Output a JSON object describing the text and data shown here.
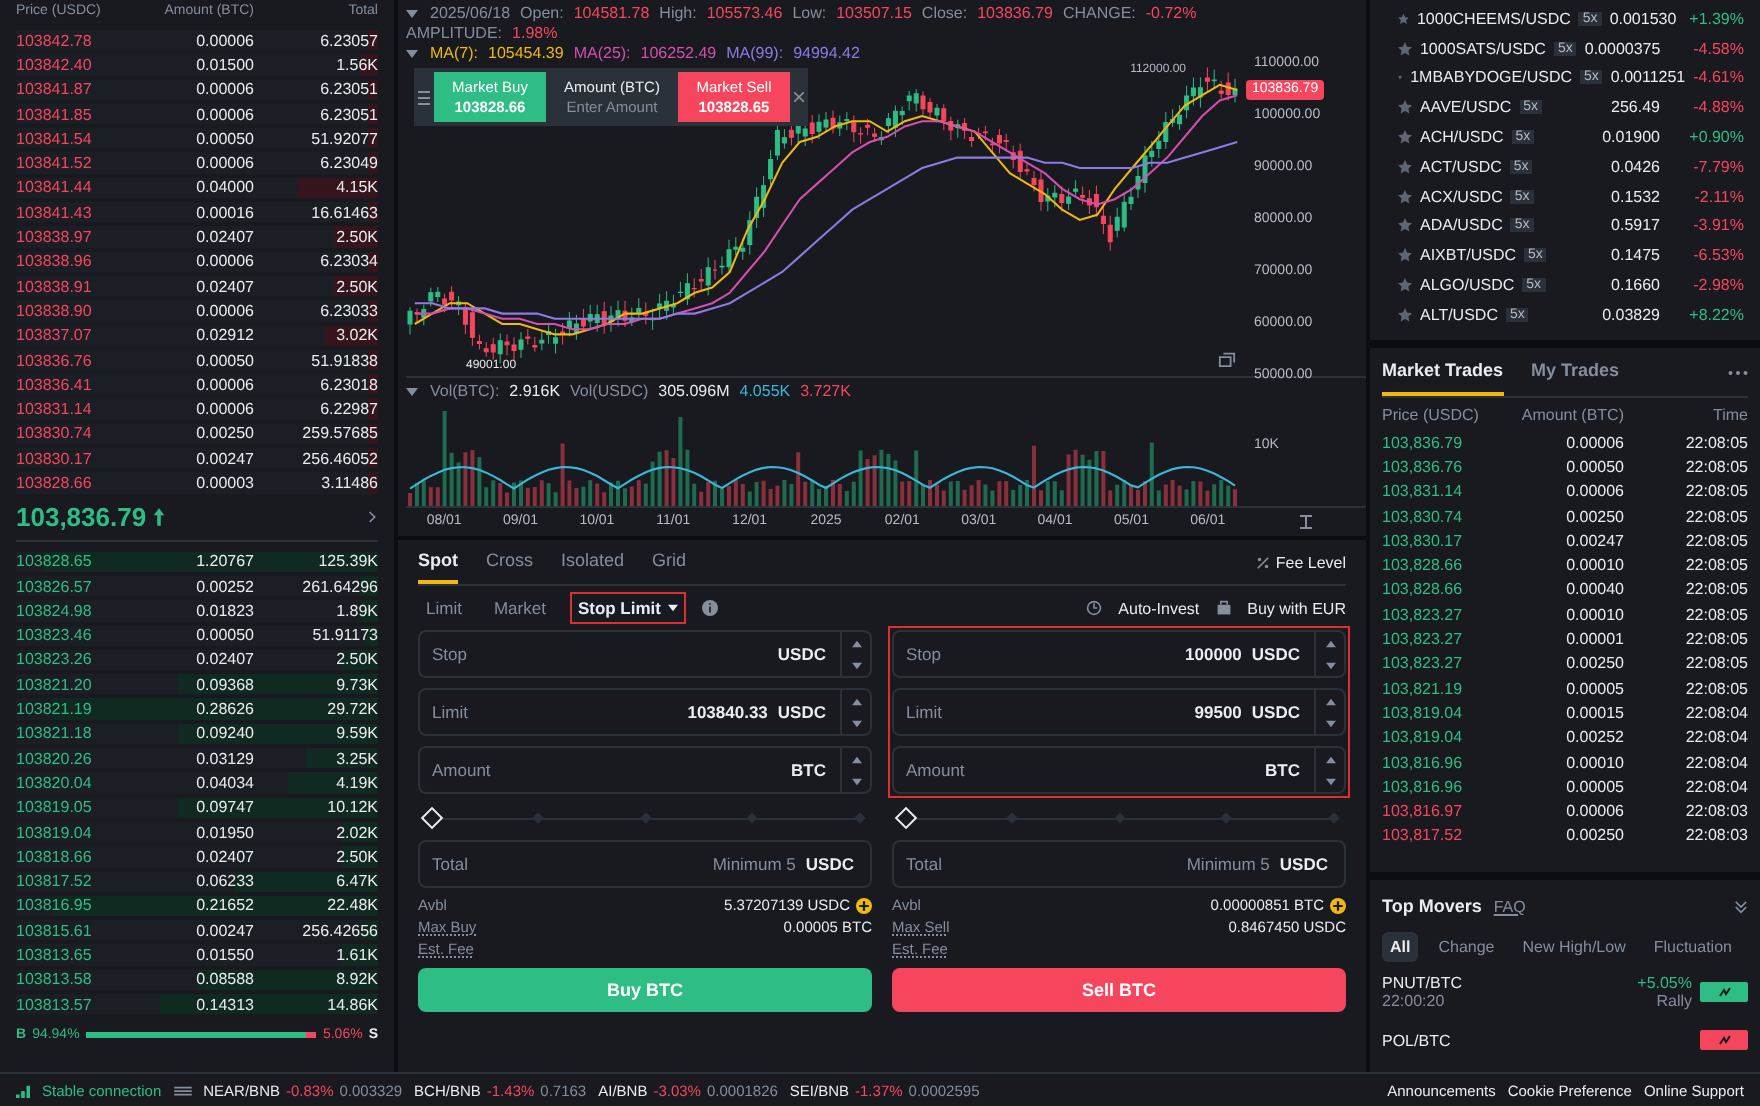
{
  "order_book": {
    "columns": [
      "Price (USDC)",
      "Amount (BTC)",
      "Total"
    ],
    "asks": [
      {
        "price": "103842.78",
        "amount": "0.00006",
        "total": "6.23057",
        "level": 0.03
      },
      {
        "price": "103842.40",
        "amount": "0.01500",
        "total": "1.56K",
        "level": 0.05
      },
      {
        "price": "103841.87",
        "amount": "0.00006",
        "total": "6.23051",
        "level": 0.03
      },
      {
        "price": "103841.85",
        "amount": "0.00006",
        "total": "6.23051",
        "level": 0.03
      },
      {
        "price": "103841.54",
        "amount": "0.00050",
        "total": "51.92077",
        "level": 0.03
      },
      {
        "price": "103841.52",
        "amount": "0.00006",
        "total": "6.23049",
        "level": 0.03
      },
      {
        "price": "103841.44",
        "amount": "0.04000",
        "total": "4.15K",
        "level": 0.22
      },
      {
        "price": "103841.43",
        "amount": "0.00016",
        "total": "16.61463",
        "level": 0.03
      },
      {
        "price": "103838.97",
        "amount": "0.02407",
        "total": "2.50K",
        "level": 0.12
      },
      {
        "price": "103838.96",
        "amount": "0.00006",
        "total": "6.23034",
        "level": 0.03
      },
      {
        "price": "103838.91",
        "amount": "0.02407",
        "total": "2.50K",
        "level": 0.12
      },
      {
        "price": "103838.90",
        "amount": "0.00006",
        "total": "6.23033",
        "level": 0.03
      },
      {
        "price": "103837.07",
        "amount": "0.02912",
        "total": "3.02K",
        "level": 0.15
      },
      {
        "price": "103836.76",
        "amount": "0.00050",
        "total": "51.91838",
        "level": 0.03
      },
      {
        "price": "103836.41",
        "amount": "0.00006",
        "total": "6.23018",
        "level": 0.03
      },
      {
        "price": "103831.14",
        "amount": "0.00006",
        "total": "6.22987",
        "level": 0.03
      },
      {
        "price": "103830.74",
        "amount": "0.00250",
        "total": "259.57685",
        "level": 0.03
      },
      {
        "price": "103830.17",
        "amount": "0.00247",
        "total": "256.46052",
        "level": 0.03
      },
      {
        "price": "103828.66",
        "amount": "0.00003",
        "total": "3.11486",
        "level": 0.03
      }
    ],
    "last_price": "103,836.79",
    "bids": [
      {
        "price": "103828.65",
        "amount": "1.20767",
        "total": "125.39K",
        "level": 0.92
      },
      {
        "price": "103826.57",
        "amount": "0.00252",
        "total": "261.64296",
        "level": 0.05
      },
      {
        "price": "103824.98",
        "amount": "0.01823",
        "total": "1.89K",
        "level": 0.05
      },
      {
        "price": "103823.46",
        "amount": "0.00050",
        "total": "51.91173",
        "level": 0.04
      },
      {
        "price": "103823.26",
        "amount": "0.02407",
        "total": "2.50K",
        "level": 0.1
      },
      {
        "price": "103821.20",
        "amount": "0.09368",
        "total": "9.73K",
        "level": 0.55
      },
      {
        "price": "103821.19",
        "amount": "0.28626",
        "total": "29.72K",
        "level": 0.9
      },
      {
        "price": "103821.18",
        "amount": "0.09240",
        "total": "9.59K",
        "level": 0.55
      },
      {
        "price": "103820.26",
        "amount": "0.03129",
        "total": "3.25K",
        "level": 0.2
      },
      {
        "price": "103820.04",
        "amount": "0.04034",
        "total": "4.19K",
        "level": 0.25
      },
      {
        "price": "103819.05",
        "amount": "0.09747",
        "total": "10.12K",
        "level": 0.55
      },
      {
        "price": "103819.04",
        "amount": "0.01950",
        "total": "2.02K",
        "level": 0.1
      },
      {
        "price": "103818.66",
        "amount": "0.02407",
        "total": "2.50K",
        "level": 0.1
      },
      {
        "price": "103817.52",
        "amount": "0.06233",
        "total": "6.47K",
        "level": 0.4
      },
      {
        "price": "103816.95",
        "amount": "0.21652",
        "total": "22.48K",
        "level": 0.9
      },
      {
        "price": "103815.61",
        "amount": "0.00247",
        "total": "256.42656",
        "level": 0.05
      },
      {
        "price": "103813.65",
        "amount": "0.01550",
        "total": "1.61K",
        "level": 0.1
      },
      {
        "price": "103813.58",
        "amount": "0.08588",
        "total": "8.92K",
        "level": 0.5
      },
      {
        "price": "103813.57",
        "amount": "0.14313",
        "total": "14.86K",
        "level": 0.6
      }
    ],
    "ratio": {
      "buy_label": "B",
      "buy_share": "94.94%",
      "sell_share": "5.06%",
      "sell_label": "S",
      "level": 0.9494
    }
  },
  "chart": {
    "date": "2025/06/18",
    "stats": [
      {
        "label": "Open:",
        "value": "104581.78"
      },
      {
        "label": "High:",
        "value": "105573.46"
      },
      {
        "label": "Low:",
        "value": "103507.15"
      },
      {
        "label": "Close:",
        "value": "103836.79"
      },
      {
        "label": "CHANGE:",
        "value": "-0.72%"
      },
      {
        "label": "AMPLITUDE:",
        "value": "1.98%"
      }
    ],
    "moving_averages": [
      {
        "value": "105454.39",
        "color": "#f0b90b"
      },
      {
        "value": "106252.49",
        "color": "#d54fb0"
      },
      {
        "value": "94994.42",
        "color": "#8f7ae6"
      }
    ],
    "volume": [
      {
        "label": "Vol(BTC):",
        "value": "2.916K",
        "color": "#eaecef"
      },
      {
        "label": "Vol(USDC)",
        "value": "305.096M",
        "color": "#eaecef"
      },
      {
        "value": "4.055K",
        "color": "#3bb8d8"
      },
      {
        "value": "3.727K",
        "color": "#f6465d"
      }
    ],
    "high_marker": "112000.00",
    "low_marker": "49001.00",
    "price_tag": "103836.79",
    "x_ticks": [
      "08/01",
      "09/01",
      "10/01",
      "11/01",
      "12/01",
      "2025",
      "02/01",
      "03/01",
      "04/01",
      "05/01",
      "06/01"
    ],
    "chart_data": {
      "type": "line",
      "ylim": [
        50000,
        110000
      ],
      "yticks": [
        {
          "value": 110000,
          "label": "110000.00"
        },
        {
          "value": 100000,
          "label": "100000.00"
        },
        {
          "value": 90000,
          "label": "90000.00"
        },
        {
          "value": 80000,
          "label": "80000.00"
        },
        {
          "value": 70000,
          "label": "70000.00"
        },
        {
          "value": 60000,
          "label": "60000.00"
        },
        {
          "value": 50000,
          "label": "50000.00"
        }
      ],
      "series": [
        {
          "name": "MA(7):",
          "color": "#f0b90b",
          "values": [
            60000,
            62000,
            64000,
            64000,
            62000,
            60000,
            60000,
            59000,
            58000,
            58000,
            59000,
            60000,
            62000,
            62000,
            63000,
            64000,
            66000,
            67000,
            70000,
            78000,
            84000,
            91000,
            95000,
            96000,
            98000,
            99000,
            99000,
            97000,
            99000,
            100000,
            99000,
            98000,
            97000,
            93000,
            89000,
            87000,
            85000,
            82000,
            80000,
            81000,
            86000,
            90000,
            94000,
            98000,
            102000,
            104000,
            106000,
            105000
          ]
        },
        {
          "name": "MA(25):",
          "color": "#d54fb0",
          "values": [
            62000,
            62000,
            63000,
            63000,
            62000,
            61000,
            61000,
            60000,
            60000,
            59000,
            59000,
            60000,
            60000,
            61000,
            61000,
            62000,
            63000,
            64000,
            66000,
            70000,
            74000,
            79000,
            84000,
            87000,
            90000,
            93000,
            95000,
            96000,
            98000,
            99000,
            99000,
            98000,
            97000,
            95000,
            93000,
            91000,
            89000,
            86000,
            84000,
            83000,
            84000,
            86000,
            89000,
            92000,
            96000,
            100000,
            103000,
            104000
          ]
        },
        {
          "name": "MA(99):",
          "color": "#8f7ae6",
          "values": [
            64000,
            64000,
            63000,
            63000,
            63000,
            62000,
            62000,
            62000,
            61000,
            61000,
            61000,
            61000,
            61000,
            61000,
            61000,
            62000,
            62000,
            63000,
            64000,
            66000,
            68000,
            70000,
            73000,
            76000,
            79000,
            82000,
            84000,
            86000,
            88000,
            90000,
            91000,
            92000,
            92000,
            92000,
            92000,
            92000,
            91000,
            91000,
            90000,
            90000,
            90000,
            90000,
            91000,
            91000,
            92000,
            93000,
            94000,
            95000
          ]
        }
      ]
    },
    "volume_tick": "10K",
    "market_widget": {
      "buy_label": "Market Buy",
      "buy_price": "103828.66",
      "amount_label": "Amount (BTC)",
      "amount_placeholder": "Enter Amount",
      "sell_label": "Market Sell",
      "sell_price": "103828.65"
    }
  },
  "order_form": {
    "tabs": [
      {
        "label": "Spot",
        "selected": true
      },
      {
        "label": "Cross",
        "selected": false
      },
      {
        "label": "Isolated",
        "selected": false
      },
      {
        "label": "Grid",
        "selected": false
      }
    ],
    "fee_level": "Fee Level",
    "order_types": [
      {
        "label": "Limit",
        "selected": false,
        "highlighted": false
      },
      {
        "label": "Market",
        "selected": false,
        "highlighted": false
      },
      {
        "label": "Stop Limit",
        "selected": true,
        "highlighted": true
      }
    ],
    "auto_invest": "Auto-Invest",
    "buy_with": "Buy with EUR",
    "sides": [
      {
        "kind": "buy",
        "highlighted": false,
        "fields": [
          {
            "label": "Stop",
            "unit": "USDC"
          },
          {
            "label": "Limit",
            "value": "103840.33",
            "unit": "USDC"
          },
          {
            "label": "Amount",
            "unit": "BTC"
          }
        ],
        "level": 0,
        "total": {
          "label": "Total",
          "placeholder": "Minimum 5",
          "unit": "USDC"
        },
        "info": [
          {
            "kind": "balance",
            "label": "Avbl",
            "value": "5.37207139 USDC"
          },
          {
            "kind": "max",
            "label": "Max Buy",
            "value": "0.00005 BTC"
          },
          {
            "kind": "fee",
            "label": "Est. Fee"
          }
        ],
        "button": "Buy BTC"
      },
      {
        "kind": "sell",
        "highlighted": true,
        "fields": [
          {
            "label": "Stop",
            "value": "100000",
            "unit": "USDC"
          },
          {
            "label": "Limit",
            "value": "99500",
            "unit": "USDC"
          },
          {
            "label": "Amount",
            "unit": "BTC"
          }
        ],
        "level": 0,
        "total": {
          "label": "Total",
          "placeholder": "Minimum 5",
          "unit": "USDC"
        },
        "info": [
          {
            "kind": "balance",
            "label": "Avbl",
            "value": "0.00000851 BTC"
          },
          {
            "kind": "max",
            "label": "Max Sell",
            "value": "0.8467450 USDC"
          },
          {
            "kind": "fee",
            "label": "Est. Fee"
          }
        ],
        "button": "Sell BTC"
      }
    ]
  },
  "pairs": [
    {
      "pair": "1000CHEEMS/USDC",
      "leverage": "5x",
      "price": "0.001530",
      "change": "+1.39%",
      "color": "#2ebd85"
    },
    {
      "pair": "1000SATS/USDC",
      "leverage": "5x",
      "price": "0.0000375",
      "change": "-4.58%",
      "color": "#f6465d"
    },
    {
      "pair": "1MBABYDOGE/USDC",
      "leverage": "5x",
      "price": "0.0011251",
      "change": "-4.61%",
      "color": "#f6465d"
    },
    {
      "pair": "AAVE/USDC",
      "leverage": "5x",
      "price": "256.49",
      "change": "-4.88%",
      "color": "#f6465d"
    },
    {
      "pair": "ACH/USDC",
      "leverage": "5x",
      "price": "0.01900",
      "change": "+0.90%",
      "color": "#2ebd85"
    },
    {
      "pair": "ACT/USDC",
      "leverage": "5x",
      "price": "0.0426",
      "change": "-7.79%",
      "color": "#f6465d"
    },
    {
      "pair": "ACX/USDC",
      "leverage": "5x",
      "price": "0.1532",
      "change": "-2.11%",
      "color": "#f6465d"
    },
    {
      "pair": "ADA/USDC",
      "leverage": "5x",
      "price": "0.5917",
      "change": "-3.91%",
      "color": "#f6465d"
    },
    {
      "pair": "AIXBT/USDC",
      "leverage": "5x",
      "price": "0.1475",
      "change": "-6.53%",
      "color": "#f6465d"
    },
    {
      "pair": "ALGO/USDC",
      "leverage": "5x",
      "price": "0.1660",
      "change": "-2.98%",
      "color": "#f6465d"
    },
    {
      "pair": "ALT/USDC",
      "leverage": "5x",
      "price": "0.03829",
      "change": "+8.22%",
      "color": "#2ebd85"
    }
  ],
  "trades": {
    "tabs": [
      {
        "label": "Market Trades",
        "selected": true
      },
      {
        "label": "My Trades",
        "selected": false
      }
    ],
    "columns": [
      "Price (USDC)",
      "Amount (BTC)",
      "Time"
    ],
    "rows": [
      {
        "price": "103,836.79",
        "amount": "0.00006",
        "time": "22:08:05",
        "color": "#2ebd85"
      },
      {
        "price": "103,836.76",
        "amount": "0.00050",
        "time": "22:08:05",
        "color": "#2ebd85"
      },
      {
        "price": "103,831.14",
        "amount": "0.00006",
        "time": "22:08:05",
        "color": "#2ebd85"
      },
      {
        "price": "103,830.74",
        "amount": "0.00250",
        "time": "22:08:05",
        "color": "#2ebd85"
      },
      {
        "price": "103,830.17",
        "amount": "0.00247",
        "time": "22:08:05",
        "color": "#2ebd85"
      },
      {
        "price": "103,828.66",
        "amount": "0.00010",
        "time": "22:08:05",
        "color": "#2ebd85"
      },
      {
        "price": "103,828.66",
        "amount": "0.00040",
        "time": "22:08:05",
        "color": "#2ebd85"
      },
      {
        "price": "103,823.27",
        "amount": "0.00010",
        "time": "22:08:05",
        "color": "#2ebd85"
      },
      {
        "price": "103,823.27",
        "amount": "0.00001",
        "time": "22:08:05",
        "color": "#2ebd85"
      },
      {
        "price": "103,823.27",
        "amount": "0.00250",
        "time": "22:08:05",
        "color": "#2ebd85"
      },
      {
        "price": "103,821.19",
        "amount": "0.00005",
        "time": "22:08:05",
        "color": "#2ebd85"
      },
      {
        "price": "103,819.04",
        "amount": "0.00015",
        "time": "22:08:04",
        "color": "#2ebd85"
      },
      {
        "price": "103,819.04",
        "amount": "0.00252",
        "time": "22:08:04",
        "color": "#2ebd85"
      },
      {
        "price": "103,816.96",
        "amount": "0.00010",
        "time": "22:08:04",
        "color": "#2ebd85"
      },
      {
        "price": "103,816.96",
        "amount": "0.00005",
        "time": "22:08:04",
        "color": "#2ebd85"
      },
      {
        "price": "103,816.97",
        "amount": "0.00006",
        "time": "22:08:03",
        "color": "#f6465d"
      },
      {
        "price": "103,817.52",
        "amount": "0.00250",
        "time": "22:08:03",
        "color": "#f6465d"
      }
    ]
  },
  "top_movers": {
    "title": "Top Movers",
    "faq": "FAQ",
    "tabs": [
      {
        "label": "All",
        "selected": true
      },
      {
        "label": "Change",
        "selected": false
      },
      {
        "label": "New High/Low",
        "selected": false
      },
      {
        "label": "Fluctuation",
        "selected": false
      }
    ],
    "items": [
      {
        "pair": "PNUT/BTC",
        "time": "22:00:20",
        "change": "+5.05%",
        "tag": "Rally",
        "color": "#2ebd85"
      },
      {
        "pair": "POL/BTC",
        "color": "#f6465d"
      }
    ]
  },
  "status_bar": {
    "connection": "Stable connection",
    "tickers": [
      {
        "pair": "NEAR/BNB",
        "change": "-0.83%",
        "price": "0.003329"
      },
      {
        "pair": "BCH/BNB",
        "change": "-1.43%",
        "price": "0.7163"
      },
      {
        "pair": "AI/BNB",
        "change": "-3.03%",
        "price": "0.0001826"
      },
      {
        "pair": "SEI/BNB",
        "change": "-1.37%",
        "price": "0.0002595"
      }
    ],
    "links": [
      "Announcements",
      "Cookie Preference",
      "Online Support"
    ]
  }
}
